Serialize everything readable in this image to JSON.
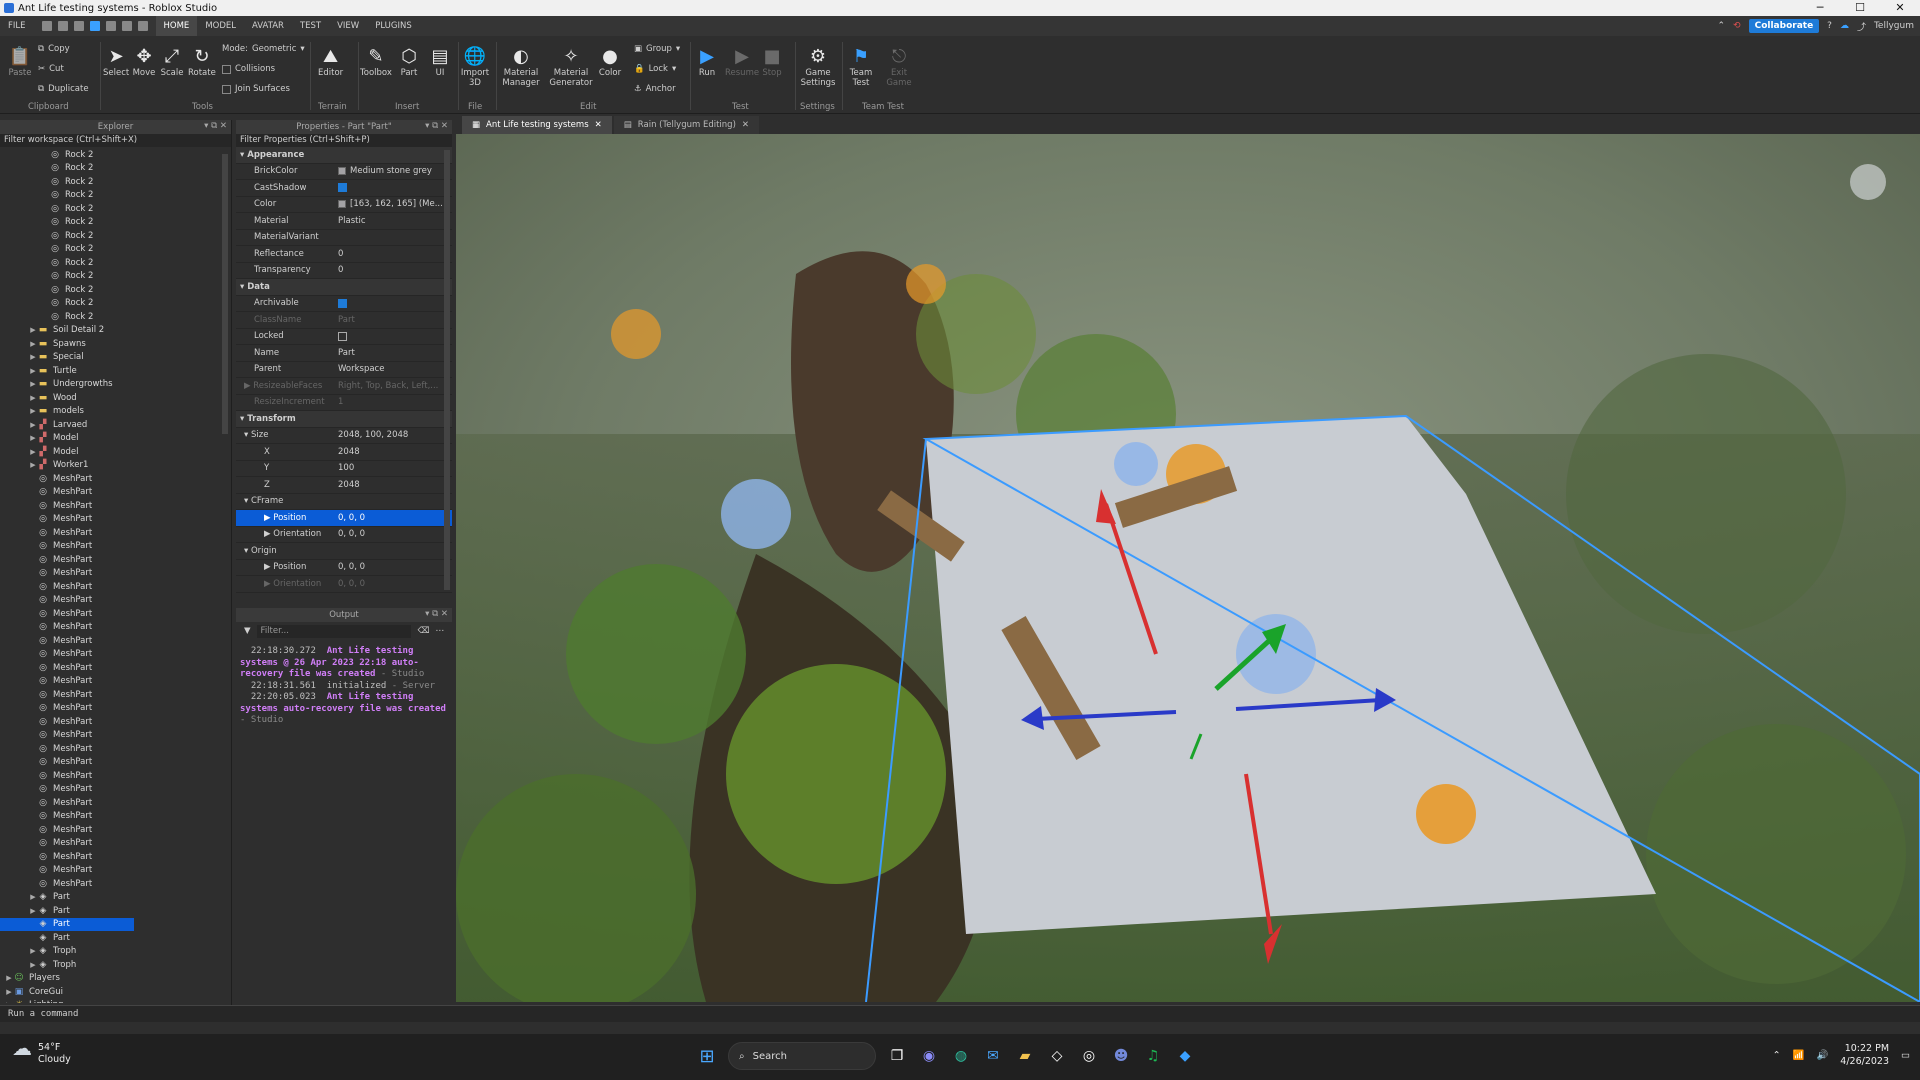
{
  "window": {
    "title": "Ant Life testing systems - Roblox Studio"
  },
  "menu": {
    "items": [
      "FILE",
      "HOME",
      "MODEL",
      "AVATAR",
      "TEST",
      "VIEW",
      "PLUGINS"
    ],
    "collaborate": "Collaborate",
    "user": "Tellygum"
  },
  "ribbon": {
    "copy": "Copy",
    "cut": "Cut",
    "duplicate": "Duplicate",
    "paste": "Paste",
    "clipboard": "Clipboard",
    "select": "Select",
    "move": "Move",
    "scale": "Scale",
    "rotate": "Rotate",
    "mode_label": "Mode:",
    "mode_value": "Geometric",
    "collisions": "Collisions",
    "join_surfaces": "Join Surfaces",
    "tools": "Tools",
    "editor": "Editor",
    "terrain": "Terrain",
    "toolbox": "Toolbox",
    "part": "Part",
    "ui": "UI",
    "insert": "Insert",
    "import3d": "Import 3D",
    "file": "File",
    "material_manager": "Material Manager",
    "material_generator": "Material Generator",
    "color": "Color",
    "group": "Group",
    "lock": "Lock",
    "anchor": "Anchor",
    "edit": "Edit",
    "run": "Run",
    "resume": "Resume",
    "stop": "Stop",
    "test": "Test",
    "game_settings": "Game Settings",
    "settings": "Settings",
    "team_test": "Team Test",
    "exit_game": "Exit Game",
    "team_test_group": "Team Test"
  },
  "explorer": {
    "title": "Explorer",
    "filter": "Filter workspace (Ctrl+Shift+X)",
    "nodes": [
      {
        "label": "Rock 2",
        "indent": 3,
        "icon": "mesh",
        "arrow": false
      },
      {
        "label": "Rock 2",
        "indent": 3,
        "icon": "mesh",
        "arrow": false
      },
      {
        "label": "Rock 2",
        "indent": 3,
        "icon": "mesh",
        "arrow": false
      },
      {
        "label": "Rock 2",
        "indent": 3,
        "icon": "mesh",
        "arrow": false
      },
      {
        "label": "Rock 2",
        "indent": 3,
        "icon": "mesh",
        "arrow": false
      },
      {
        "label": "Rock 2",
        "indent": 3,
        "icon": "mesh",
        "arrow": false
      },
      {
        "label": "Rock 2",
        "indent": 3,
        "icon": "mesh",
        "arrow": false
      },
      {
        "label": "Rock 2",
        "indent": 3,
        "icon": "mesh",
        "arrow": false
      },
      {
        "label": "Rock 2",
        "indent": 3,
        "icon": "mesh",
        "arrow": false
      },
      {
        "label": "Rock 2",
        "indent": 3,
        "icon": "mesh",
        "arrow": false
      },
      {
        "label": "Rock 2",
        "indent": 3,
        "icon": "mesh",
        "arrow": false
      },
      {
        "label": "Rock 2",
        "indent": 3,
        "icon": "mesh",
        "arrow": false
      },
      {
        "label": "Rock 2",
        "indent": 3,
        "icon": "mesh",
        "arrow": false
      },
      {
        "label": "Soil Detail 2",
        "indent": 2,
        "icon": "folder",
        "arrow": true
      },
      {
        "label": "Spawns",
        "indent": 2,
        "icon": "folder",
        "arrow": true
      },
      {
        "label": "Special",
        "indent": 2,
        "icon": "folder",
        "arrow": true
      },
      {
        "label": "Turtle",
        "indent": 2,
        "icon": "folder",
        "arrow": true
      },
      {
        "label": "Undergrowths",
        "indent": 2,
        "icon": "folder",
        "arrow": true
      },
      {
        "label": "Wood",
        "indent": 2,
        "icon": "folder",
        "arrow": true
      },
      {
        "label": "models",
        "indent": 2,
        "icon": "folder",
        "arrow": true
      },
      {
        "label": "Larvaed",
        "indent": 2,
        "icon": "model",
        "arrow": true
      },
      {
        "label": "Model",
        "indent": 2,
        "icon": "model",
        "arrow": true
      },
      {
        "label": "Model",
        "indent": 2,
        "icon": "model",
        "arrow": true
      },
      {
        "label": "Worker1",
        "indent": 2,
        "icon": "model",
        "arrow": true
      },
      {
        "label": "MeshPart",
        "indent": 2,
        "icon": "mesh",
        "arrow": false
      },
      {
        "label": "MeshPart",
        "indent": 2,
        "icon": "mesh",
        "arrow": false
      },
      {
        "label": "MeshPart",
        "indent": 2,
        "icon": "mesh",
        "arrow": false
      },
      {
        "label": "MeshPart",
        "indent": 2,
        "icon": "mesh",
        "arrow": false
      },
      {
        "label": "MeshPart",
        "indent": 2,
        "icon": "mesh",
        "arrow": false
      },
      {
        "label": "MeshPart",
        "indent": 2,
        "icon": "mesh",
        "arrow": false
      },
      {
        "label": "MeshPart",
        "indent": 2,
        "icon": "mesh",
        "arrow": false
      },
      {
        "label": "MeshPart",
        "indent": 2,
        "icon": "mesh",
        "arrow": false
      },
      {
        "label": "MeshPart",
        "indent": 2,
        "icon": "mesh",
        "arrow": false
      },
      {
        "label": "MeshPart",
        "indent": 2,
        "icon": "mesh",
        "arrow": false
      },
      {
        "label": "MeshPart",
        "indent": 2,
        "icon": "mesh",
        "arrow": false
      },
      {
        "label": "MeshPart",
        "indent": 2,
        "icon": "mesh",
        "arrow": false
      },
      {
        "label": "MeshPart",
        "indent": 2,
        "icon": "mesh",
        "arrow": false
      },
      {
        "label": "MeshPart",
        "indent": 2,
        "icon": "mesh",
        "arrow": false
      },
      {
        "label": "MeshPart",
        "indent": 2,
        "icon": "mesh",
        "arrow": false
      },
      {
        "label": "MeshPart",
        "indent": 2,
        "icon": "mesh",
        "arrow": false
      },
      {
        "label": "MeshPart",
        "indent": 2,
        "icon": "mesh",
        "arrow": false
      },
      {
        "label": "MeshPart",
        "indent": 2,
        "icon": "mesh",
        "arrow": false
      },
      {
        "label": "MeshPart",
        "indent": 2,
        "icon": "mesh",
        "arrow": false
      },
      {
        "label": "MeshPart",
        "indent": 2,
        "icon": "mesh",
        "arrow": false
      },
      {
        "label": "MeshPart",
        "indent": 2,
        "icon": "mesh",
        "arrow": false
      },
      {
        "label": "MeshPart",
        "indent": 2,
        "icon": "mesh",
        "arrow": false
      },
      {
        "label": "MeshPart",
        "indent": 2,
        "icon": "mesh",
        "arrow": false
      },
      {
        "label": "MeshPart",
        "indent": 2,
        "icon": "mesh",
        "arrow": false
      },
      {
        "label": "MeshPart",
        "indent": 2,
        "icon": "mesh",
        "arrow": false
      },
      {
        "label": "MeshPart",
        "indent": 2,
        "icon": "mesh",
        "arrow": false
      },
      {
        "label": "MeshPart",
        "indent": 2,
        "icon": "mesh",
        "arrow": false
      },
      {
        "label": "MeshPart",
        "indent": 2,
        "icon": "mesh",
        "arrow": false
      },
      {
        "label": "MeshPart",
        "indent": 2,
        "icon": "mesh",
        "arrow": false
      },
      {
        "label": "MeshPart",
        "indent": 2,
        "icon": "mesh",
        "arrow": false
      },
      {
        "label": "MeshPart",
        "indent": 2,
        "icon": "mesh",
        "arrow": false
      },
      {
        "label": "Part",
        "indent": 2,
        "icon": "part",
        "arrow": true
      },
      {
        "label": "Part",
        "indent": 2,
        "icon": "part",
        "arrow": true
      },
      {
        "label": "Part",
        "indent": 2,
        "icon": "part",
        "arrow": false,
        "selected": true
      },
      {
        "label": "Part",
        "indent": 2,
        "icon": "part",
        "arrow": false
      },
      {
        "label": "Troph",
        "indent": 2,
        "icon": "part",
        "arrow": true
      },
      {
        "label": "Troph",
        "indent": 2,
        "icon": "part",
        "arrow": true
      },
      {
        "label": "Players",
        "indent": 0,
        "icon": "players",
        "arrow": true
      },
      {
        "label": "CoreGui",
        "indent": 0,
        "icon": "gui",
        "arrow": true
      },
      {
        "label": "Lighting",
        "indent": 0,
        "icon": "light",
        "arrow": true
      }
    ]
  },
  "properties": {
    "title": "Properties - Part \"Part\"",
    "filter": "Filter Properties (Ctrl+Shift+P)",
    "rows": [
      {
        "type": "cat",
        "label": "Appearance"
      },
      {
        "label": "BrickColor",
        "value": "Medium stone grey",
        "swatch": true
      },
      {
        "label": "CastShadow",
        "check": true
      },
      {
        "label": "Color",
        "value": "[163, 162, 165] (Me...",
        "swatch": true
      },
      {
        "label": "Material",
        "value": "Plastic"
      },
      {
        "label": "MaterialVariant",
        "value": ""
      },
      {
        "label": "Reflectance",
        "value": "0"
      },
      {
        "label": "Transparency",
        "value": "0"
      },
      {
        "type": "cat",
        "label": "Data"
      },
      {
        "label": "Archivable",
        "check": true
      },
      {
        "label": "ClassName",
        "value": "Part",
        "dim": true
      },
      {
        "label": "Locked",
        "check": false
      },
      {
        "label": "Name",
        "value": "Part"
      },
      {
        "label": "Parent",
        "value": "Workspace"
      },
      {
        "label": "ResizeableFaces",
        "value": "Right, Top, Back, Left,...",
        "dim": true,
        "arrow": true
      },
      {
        "label": "ResizeIncrement",
        "value": "1",
        "dim": true
      },
      {
        "type": "cat",
        "label": "Transform"
      },
      {
        "label": "Size",
        "value": "2048, 100, 2048",
        "arrow": "open"
      },
      {
        "label": "X",
        "value": "2048",
        "sub": true
      },
      {
        "label": "Y",
        "value": "100",
        "sub": true
      },
      {
        "label": "Z",
        "value": "2048",
        "sub": true
      },
      {
        "label": "CFrame",
        "value": "",
        "arrow": "open"
      },
      {
        "label": "Position",
        "value": "0, 0, 0",
        "arrow": true,
        "sub": true,
        "selected": true
      },
      {
        "label": "Orientation",
        "value": "0, 0, 0",
        "arrow": true,
        "sub": true
      },
      {
        "label": "Origin",
        "value": "",
        "arrow": "open"
      },
      {
        "label": "Position",
        "value": "0, 0, 0",
        "arrow": true,
        "sub": true
      },
      {
        "label": "Orientation",
        "value": "0, 0, 0",
        "arrow": true,
        "sub": true,
        "dim": true
      }
    ]
  },
  "output": {
    "title": "Output",
    "filter": "Filter...",
    "log": [
      {
        "time": "22:18:30.272",
        "msg": "Ant Life testing systems @ 26 Apr 2023 22:18 auto-recovery file was created",
        "src": "Studio",
        "style": "pink"
      },
      {
        "time": "22:18:31.561",
        "msg": "initialized",
        "src": "Server",
        "style": "plain"
      },
      {
        "time": "22:20:05.023",
        "msg": "Ant Life testing systems auto-recovery file was created",
        "src": "Studio",
        "style": "pink"
      }
    ]
  },
  "tabs": [
    {
      "label": "Ant Life testing systems",
      "active": true
    },
    {
      "label": "Rain (Tellygum Editing)",
      "active": false
    }
  ],
  "command": {
    "placeholder": "Run a command"
  },
  "taskbar": {
    "temp": "54°F",
    "weather": "Cloudy",
    "search": "Search",
    "time": "10:22 PM",
    "date": "4/26/2023"
  },
  "colors": {
    "accent": "#1e7bd8",
    "selection": "#0b5cd6",
    "log_highlight": "#d07ef7"
  }
}
